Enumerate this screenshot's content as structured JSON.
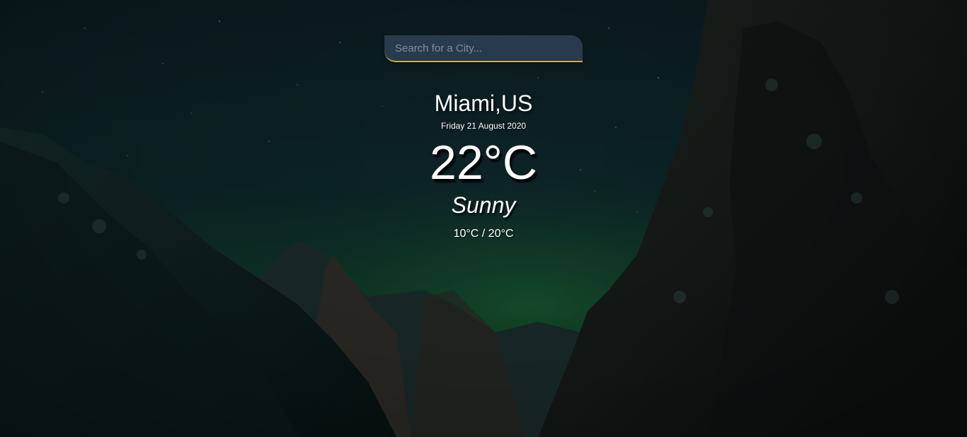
{
  "search": {
    "placeholder": "Search for a City...",
    "value": ""
  },
  "weather": {
    "location": "Miami,US",
    "date": "Friday 21 August 2020",
    "temperature": "22°C",
    "condition": "Sunny",
    "hi_low": "10°C / 20°C"
  },
  "colors": {
    "search_accent": "#d9a43f",
    "search_background": "#344860",
    "text": "#ffffff"
  }
}
